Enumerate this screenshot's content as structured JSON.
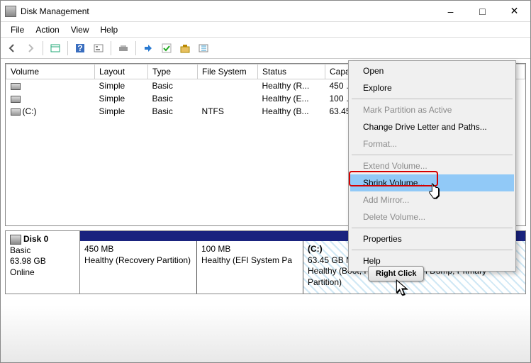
{
  "window": {
    "title": "Disk Management"
  },
  "menu": {
    "file": "File",
    "action": "Action",
    "view": "View",
    "help": "Help"
  },
  "table": {
    "headers": {
      "volume": "Volume",
      "layout": "Layout",
      "type": "Type",
      "fs": "File System",
      "status": "Status",
      "capacity": "Capa..."
    },
    "rows": [
      {
        "volume": "",
        "layout": "Simple",
        "type": "Basic",
        "fs": "",
        "status": "Healthy (R...",
        "capacity": "450 M..."
      },
      {
        "volume": "",
        "layout": "Simple",
        "type": "Basic",
        "fs": "",
        "status": "Healthy (E...",
        "capacity": "100 M..."
      },
      {
        "volume": "(C:)",
        "layout": "Simple",
        "type": "Basic",
        "fs": "NTFS",
        "status": "Healthy (B...",
        "capacity": "63.45..."
      }
    ]
  },
  "disk": {
    "name": "Disk 0",
    "type": "Basic",
    "size": "63.98 GB",
    "state": "Online",
    "parts": [
      {
        "line1": "",
        "line2": "450 MB",
        "line3": "Healthy (Recovery Partition)"
      },
      {
        "line1": "",
        "line2": "100 MB",
        "line3": "Healthy (EFI System Pa"
      },
      {
        "line1": "(C:)",
        "line2": "63.45 GB NTFS",
        "line3": "Healthy (Boot, Page File, Crash Dump, Primary Partition)"
      }
    ]
  },
  "context": {
    "open": "Open",
    "explore": "Explore",
    "mark": "Mark Partition as Active",
    "change": "Change Drive Letter and Paths...",
    "format": "Format...",
    "extend": "Extend Volume...",
    "shrink": "Shrink Volume...",
    "mirror": "Add Mirror...",
    "delete": "Delete Volume...",
    "props": "Properties",
    "help": "Help"
  },
  "tooltip": {
    "rc": "Right Click"
  }
}
